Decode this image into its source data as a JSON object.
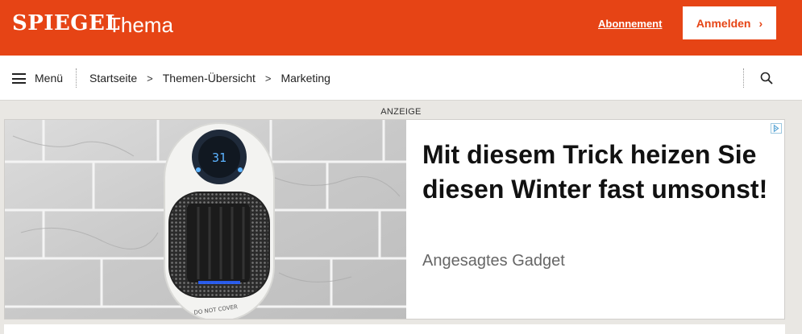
{
  "header": {
    "brand": "SPIEGEL",
    "brand_sub": "Thema",
    "subscription_label": "Abonnement",
    "login_label": "Anmelden",
    "accent_color": "#e64415"
  },
  "nav": {
    "menu_label": "Menü",
    "breadcrumbs": [
      "Startseite",
      "Themen-Übersicht",
      "Marketing"
    ],
    "search_icon": "search-icon"
  },
  "ad": {
    "label": "ANZEIGE",
    "title": "Mit diesem Trick heizen Sie diesen Winter fast umsonst!",
    "source": "Angesagtes Gadget",
    "image": {
      "display_value": "31",
      "device_label": "DO NOT COVER"
    }
  }
}
